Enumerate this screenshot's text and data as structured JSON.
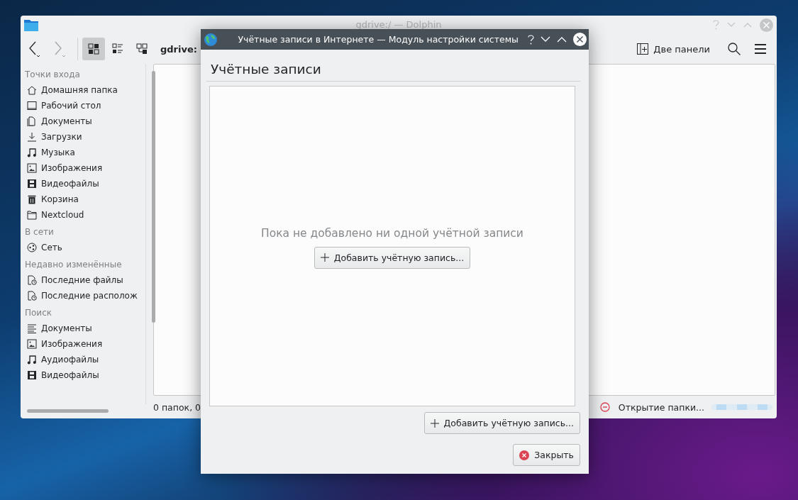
{
  "dolphin": {
    "title": "gdrive:/ — Dolphin",
    "location": "gdrive:",
    "view_modes": [
      {
        "selected": true
      },
      {
        "selected": false
      },
      {
        "selected": false
      }
    ],
    "split_button": "Две панели",
    "places": [
      {
        "heading": "Точки входа",
        "items": [
          "Домашняя папка",
          "Рабочий стол",
          "Документы",
          "Загрузки",
          "Музыка",
          "Изображения",
          "Видеофайлы",
          "Корзина",
          "Nextcloud"
        ]
      },
      {
        "heading": "В сети",
        "items": [
          "Сеть"
        ]
      },
      {
        "heading": "Недавно изменённые",
        "items": [
          "Последние файлы",
          "Последние располож"
        ]
      },
      {
        "heading": "Поиск",
        "items": [
          "Документы",
          "Изображения",
          "Аудиофайлы",
          "Видеофайлы"
        ]
      }
    ],
    "status_text": "0 папок, 0",
    "loading_text": "Открытие папки..."
  },
  "dialog": {
    "title": "Учётные записи в Интернете — Модуль настройки системы",
    "heading": "Учётные записи",
    "empty_message": "Пока не добавлено ни одной учётной записи",
    "center_button": "Добавить учётную запись...",
    "add_button": "Добавить учётную запись...",
    "close_button": "Закрыть"
  }
}
